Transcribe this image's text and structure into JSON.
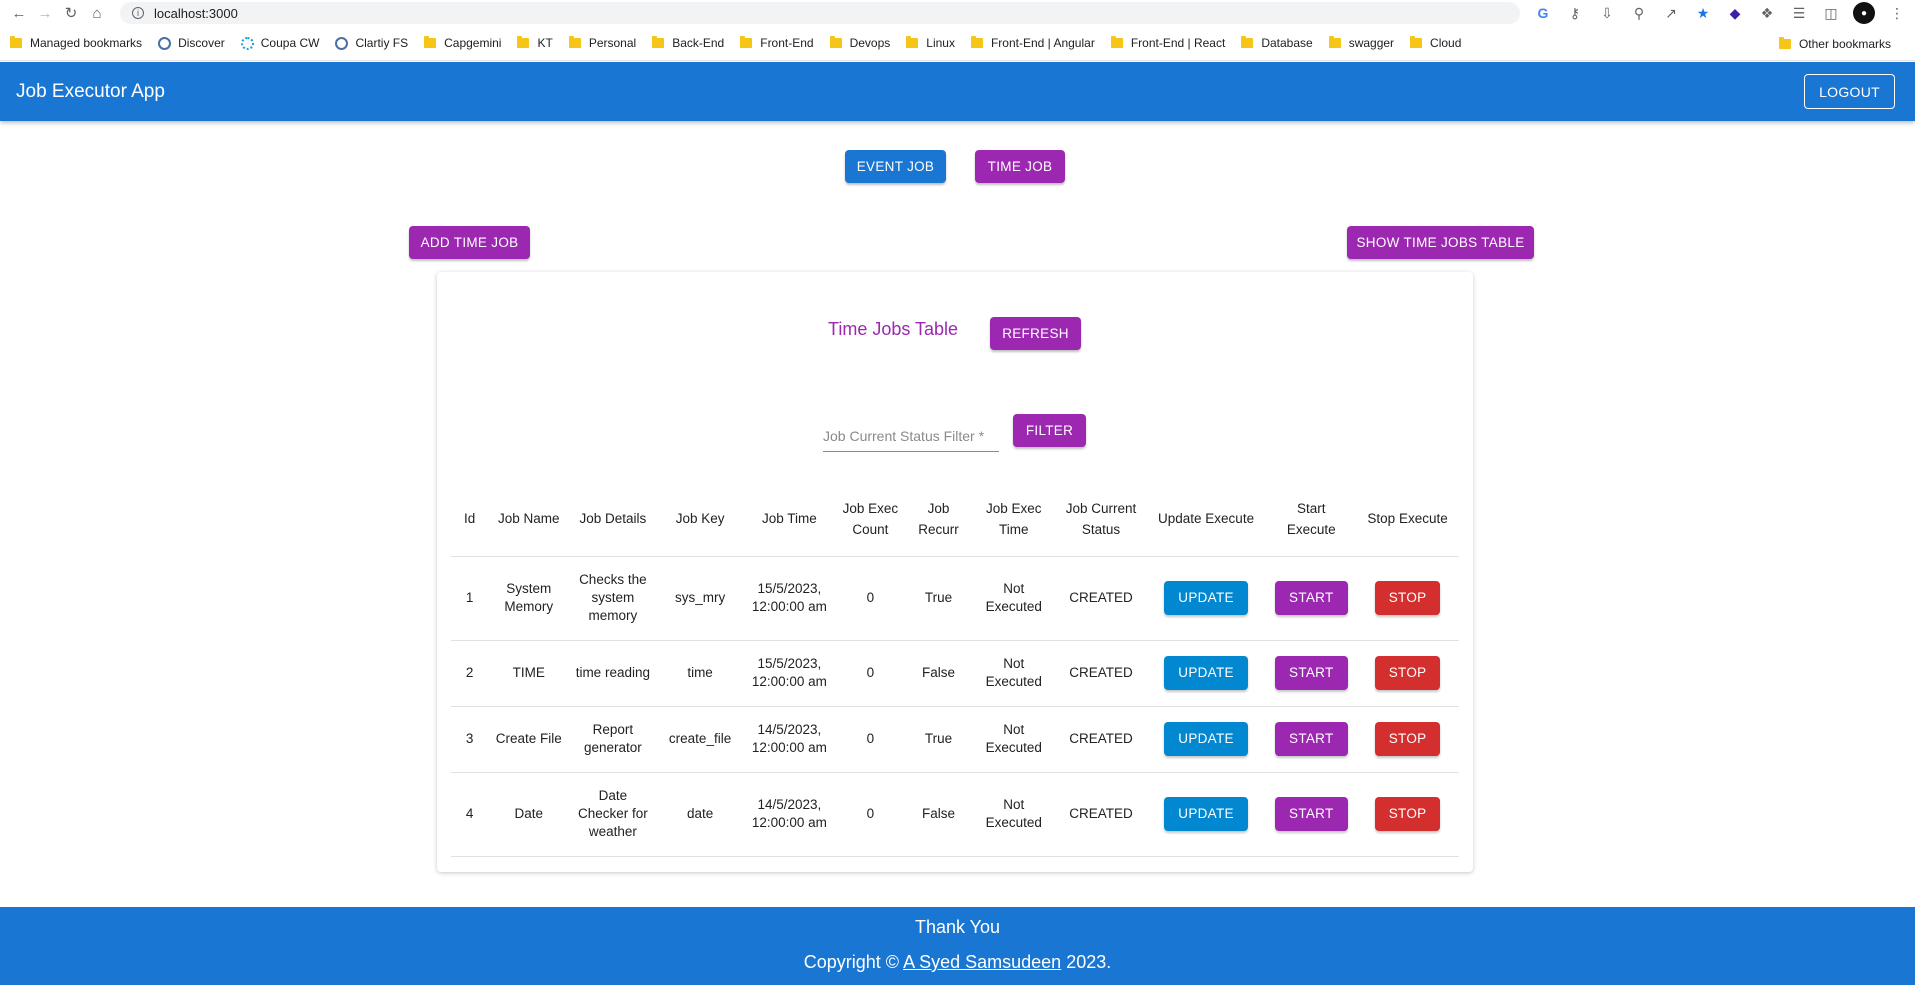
{
  "browser": {
    "url": "localhost:3000",
    "bookmarks": [
      "Managed bookmarks",
      "Discover",
      "Coupa CW",
      "Clartiy FS",
      "Capgemini",
      "KT",
      "Personal",
      "Back-End",
      "Front-End",
      "Devops",
      "Linux",
      "Front-End | Angular",
      "Front-End | React",
      "Database",
      "swagger",
      "Cloud"
    ],
    "other_bookmarks": "Other bookmarks"
  },
  "app_bar": {
    "title": "Job Executor App",
    "logout": "LOGOUT"
  },
  "mode_buttons": {
    "event_job": "EVENT JOB",
    "time_job": "TIME JOB"
  },
  "actions": {
    "add_time_job": "ADD TIME JOB",
    "show_table": "SHOW TIME JOBS TABLE"
  },
  "table_card": {
    "title": "Time Jobs Table",
    "refresh": "REFRESH",
    "filter_placeholder": "Job Current Status Filter *",
    "filter_button": "FILTER"
  },
  "table": {
    "headers": [
      "Id",
      "Job Name",
      "Job Details",
      "Job Key",
      "Job Time",
      "Job Exec Count",
      "Job Recurr",
      "Job Exec Time",
      "Job Current Status",
      "Update Execute",
      "Start Execute",
      "Stop Execute"
    ],
    "rows": [
      {
        "id": "1",
        "name": "System Memory",
        "details": "Checks the system memory",
        "key": "sys_mry",
        "time": "15/5/2023, 12:00:00 am",
        "count": "0",
        "recurr": "True",
        "exec_time": "Not Executed",
        "status": "CREATED"
      },
      {
        "id": "2",
        "name": "TIME",
        "details": "time reading",
        "key": "time",
        "time": "15/5/2023, 12:00:00 am",
        "count": "0",
        "recurr": "False",
        "exec_time": "Not Executed",
        "status": "CREATED"
      },
      {
        "id": "3",
        "name": "Create File",
        "details": "Report generator",
        "key": "create_file",
        "time": "14/5/2023, 12:00:00 am",
        "count": "0",
        "recurr": "True",
        "exec_time": "Not Executed",
        "status": "CREATED"
      },
      {
        "id": "4",
        "name": "Date",
        "details": "Date Checker for weather",
        "key": "date",
        "time": "14/5/2023, 12:00:00 am",
        "count": "0",
        "recurr": "False",
        "exec_time": "Not Executed",
        "status": "CREATED"
      }
    ],
    "button_labels": {
      "update": "UPDATE",
      "start": "START",
      "stop": "STOP"
    }
  },
  "footer": {
    "thanks": "Thank You",
    "copy_prefix": "Copyright © ",
    "author": "A Syed Samsudeen",
    "copy_suffix": " 2023."
  },
  "colors": {
    "primary": "#1976d2",
    "secondary": "#9c27b0",
    "info": "#0288d1",
    "error": "#d32f2f"
  }
}
